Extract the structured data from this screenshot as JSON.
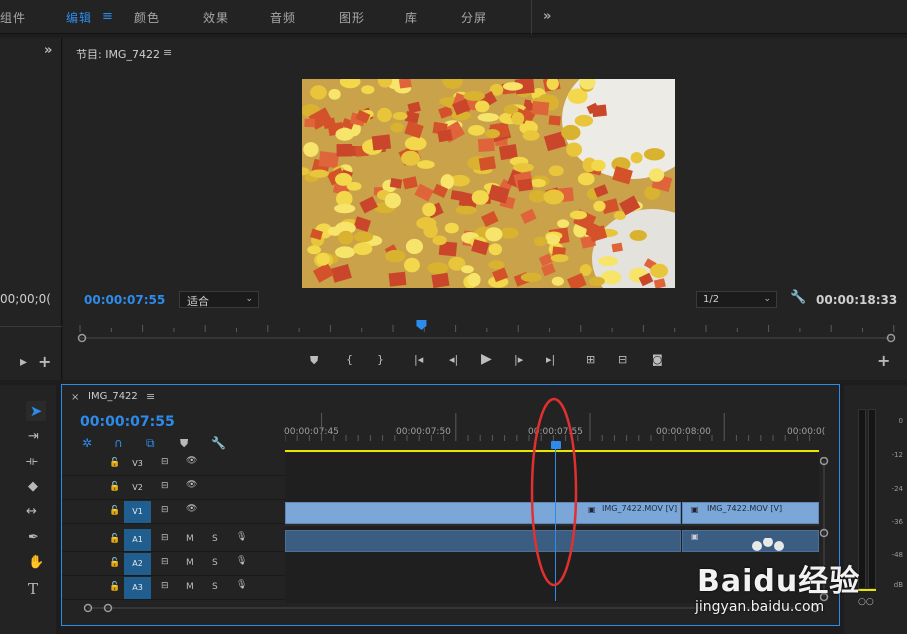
{
  "workspace_tabs": [
    {
      "label": "组件",
      "active": false
    },
    {
      "label": "编辑",
      "active": true
    },
    {
      "label": "颜色",
      "active": false
    },
    {
      "label": "效果",
      "active": false
    },
    {
      "label": "音频",
      "active": false
    },
    {
      "label": "图形",
      "active": false
    },
    {
      "label": "库",
      "active": false
    },
    {
      "label": "分屏",
      "active": false
    }
  ],
  "source": {
    "timecode": "00;00;0("
  },
  "program": {
    "title": "节目: IMG_7422",
    "current_timecode": "00:00:07:55",
    "fit": "适合",
    "resolution": "1/2",
    "duration": "00:00:18:33",
    "playhead_fraction": 0.42
  },
  "timeline": {
    "sequence": "IMG_7422",
    "timecode": "00:00:07:55",
    "ruler": [
      "00:00:07:45",
      "00:00:07:50",
      "00:00:07:55",
      "00:00:08:00",
      "00:00:0("
    ],
    "tracks": [
      {
        "name": "V3",
        "type": "video",
        "targeted": false
      },
      {
        "name": "V2",
        "type": "video",
        "targeted": false
      },
      {
        "name": "V1",
        "type": "video",
        "targeted": true
      },
      {
        "name": "A1",
        "type": "audio",
        "targeted": true
      },
      {
        "name": "A2",
        "type": "audio",
        "targeted": true
      },
      {
        "name": "A3",
        "type": "audio",
        "targeted": true
      }
    ],
    "mute_label": "M",
    "solo_label": "S",
    "clips": [
      {
        "label": "IMG_7422.MOV [V]"
      },
      {
        "label": "IMG_7422.MOV [V]"
      }
    ]
  },
  "meter": {
    "labels": [
      "0",
      "-12",
      "-24",
      "-36",
      "-48",
      "dB"
    ]
  },
  "watermark": {
    "text": "Baidu经验",
    "url": "jingyan.baidu.com"
  },
  "colors": {
    "accent": "#2d8ceb",
    "annotation": "#e03030",
    "work_area": "#e6e600"
  }
}
